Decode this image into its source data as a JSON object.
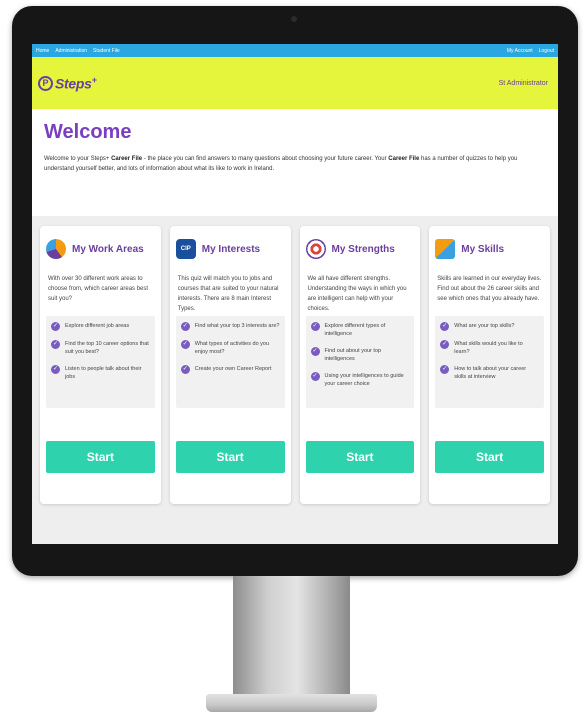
{
  "nav": {
    "left": [
      "Home",
      "Administration",
      "Student File"
    ],
    "right": [
      "My Account",
      "Logout"
    ]
  },
  "header": {
    "logo_text": "Steps",
    "logo_plus": "+",
    "user": "St Administrator"
  },
  "welcome": {
    "title": "Welcome",
    "p1": "Welcome to your Steps+ ",
    "p1_bold": "Career File",
    "p2": " - the place you can find answers to many questions about choosing your future career. Your ",
    "p2_bold": "Career File",
    "p3": " has a number of quizzes to help you understand yourself better, and lots of information about what its like to work in Ireland."
  },
  "cards": [
    {
      "title": "My Work Areas",
      "icon": "work-areas-icon",
      "desc": "With over 30 different work areas to choose from, which career areas best suit you?",
      "bullets": [
        "Explore different job areas",
        "Find the top 10 career options that suit you best?",
        "Listen to people talk about their jobs"
      ],
      "button": "Start"
    },
    {
      "title": "My Interests",
      "icon": "interests-icon",
      "icon_text": "CIP",
      "desc": "This quiz will match you to jobs and courses that are suited to your natural interests. There are 8 main Interest Types.",
      "bullets": [
        "Find what your top 3 interests are?",
        "What types of activities do you enjoy most?",
        "Create your own Career Report"
      ],
      "button": "Start"
    },
    {
      "title": "My Strengths",
      "icon": "strengths-icon",
      "desc": "We all have different strengths. Understanding the ways in which you are intelligent can help with your choices.",
      "bullets": [
        "Explore different types of intelligence",
        "Find out about your top intelligences",
        "Using your intelligences to guide your career choice"
      ],
      "button": "Start"
    },
    {
      "title": "My Skills",
      "icon": "skills-icon",
      "desc": "Skills are learned in our everyday lives. Find out about the 26 career skills and see which ones that you already have.",
      "bullets": [
        "What are your top skills?",
        "What skills would you like to learn?",
        "How to talk about your career skills at interview"
      ],
      "button": "Start"
    }
  ],
  "colors": {
    "nav": "#2aa7e0",
    "header": "#e5f53c",
    "brand_purple": "#6a3fa0",
    "start_button": "#2ed3ad"
  }
}
